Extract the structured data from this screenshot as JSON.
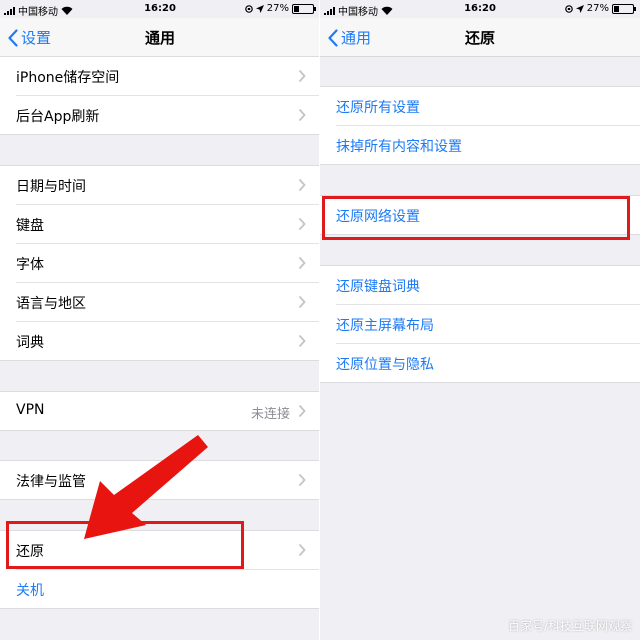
{
  "status": {
    "carrier": "中国移动",
    "time": "16:20",
    "battery": "27%",
    "battery_level": 0.27
  },
  "left": {
    "nav": {
      "back_label": "设置",
      "title": "通用"
    },
    "group1": [
      {
        "label": "iPhone储存空间"
      },
      {
        "label": "后台App刷新"
      }
    ],
    "group2": [
      {
        "label": "日期与时间"
      },
      {
        "label": "键盘"
      },
      {
        "label": "字体"
      },
      {
        "label": "语言与地区"
      },
      {
        "label": "词典"
      }
    ],
    "group3": [
      {
        "label": "VPN",
        "value": "未连接"
      }
    ],
    "group4": [
      {
        "label": "法律与监管"
      }
    ],
    "group5": [
      {
        "label": "还原"
      },
      {
        "label": "关机"
      }
    ]
  },
  "right": {
    "nav": {
      "back_label": "通用",
      "title": "还原"
    },
    "group1": [
      {
        "label": "还原所有设置"
      },
      {
        "label": "抹掉所有内容和设置"
      }
    ],
    "group2": [
      {
        "label": "还原网络设置"
      }
    ],
    "group3": [
      {
        "label": "还原键盘词典"
      },
      {
        "label": "还原主屏幕布局"
      },
      {
        "label": "还原位置与隐私"
      }
    ]
  },
  "watermark": "百家号/科技互联网观察",
  "colors": {
    "accent": "#1d7bf5",
    "highlight": "#e01a1a",
    "background": "#efeff4"
  }
}
